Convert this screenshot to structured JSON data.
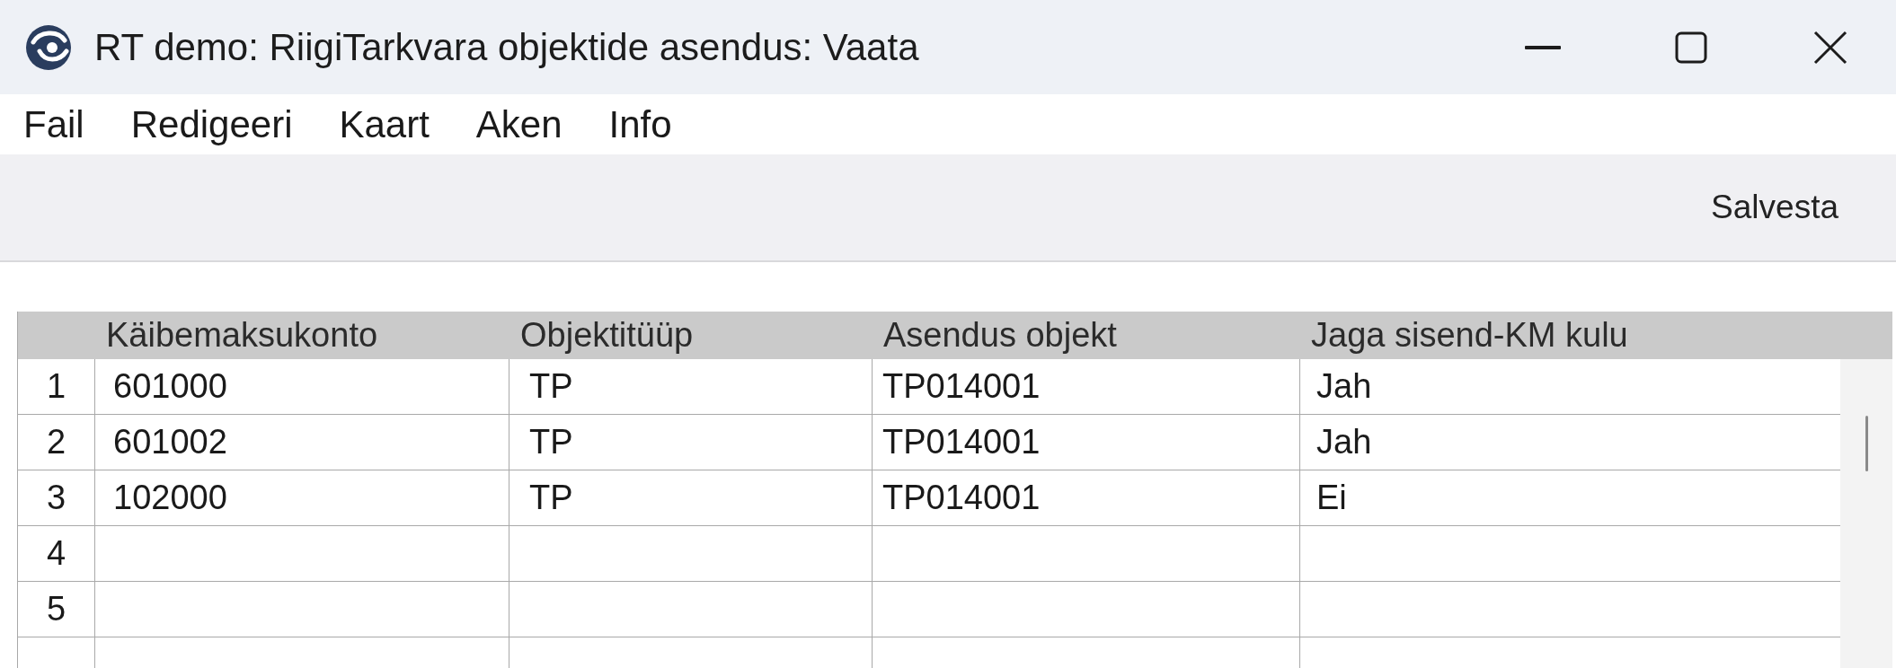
{
  "window": {
    "title": "RT demo: RiigiTarkvara objektide asendus: Vaata"
  },
  "menu_bar": {
    "items": [
      "Fail",
      "Redigeeri",
      "Kaart",
      "Aken",
      "Info"
    ]
  },
  "toolbar": {
    "buttons": [
      "Salvesta"
    ]
  },
  "table": {
    "columns": [
      "Käibemaksukonto",
      "Objektitüüp",
      "Asendus objekt",
      "Jaga sisend-KM kulu"
    ],
    "rows": [
      {
        "number": "1",
        "cells": [
          "601000",
          "TP",
          "TP014001",
          "Jah"
        ]
      },
      {
        "number": "2",
        "cells": [
          "601002",
          "TP",
          "TP014001",
          "Jah"
        ]
      },
      {
        "number": "3",
        "cells": [
          "102000",
          "TP",
          "TP014001",
          "Ei"
        ]
      },
      {
        "number": "4"
      },
      {
        "number": "5"
      }
    ]
  }
}
